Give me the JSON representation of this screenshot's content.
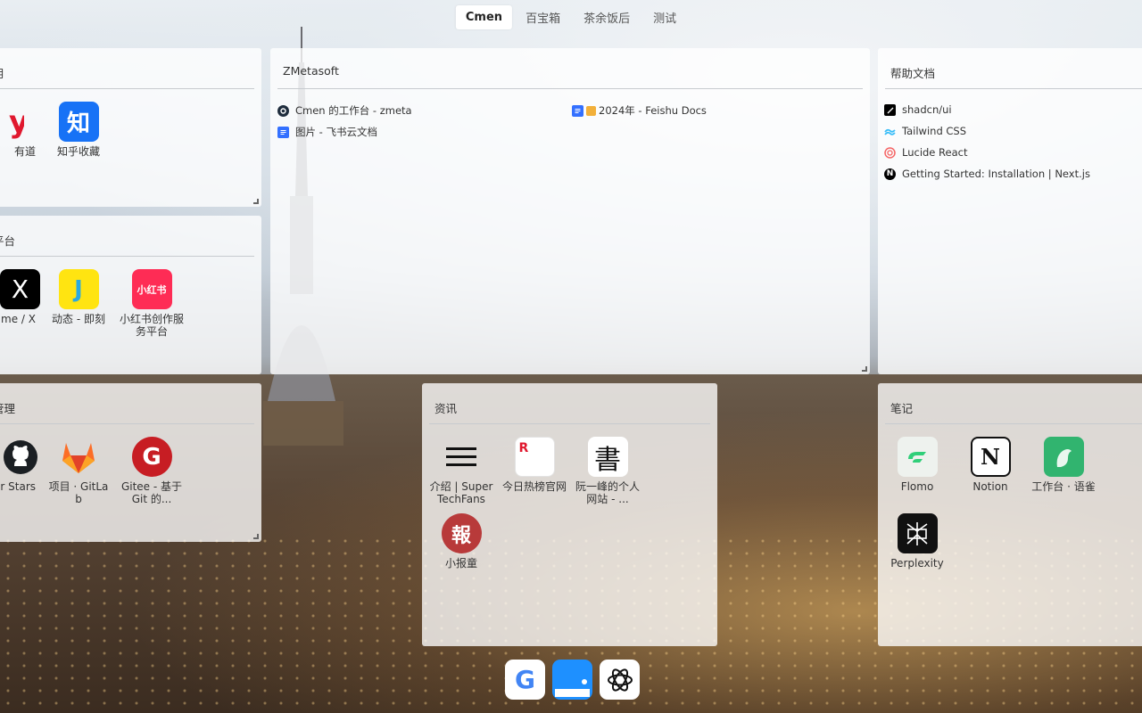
{
  "tabs": [
    "Cmen",
    "百宝箱",
    "茶余饭后",
    "测试"
  ],
  "cards": {
    "left_top": {
      "title": "用",
      "apps": [
        {
          "label": "有道",
          "icon": "youdao-icon"
        },
        {
          "label": "知乎收藏",
          "icon": "zhihu-icon",
          "glyph": "知"
        }
      ]
    },
    "left_mid": {
      "title": "平台",
      "apps": [
        {
          "label": "me / X",
          "icon": "x-icon",
          "glyph": "X"
        },
        {
          "label": "动态 - 即刻",
          "icon": "jike-icon",
          "glyph": "J"
        },
        {
          "label": "小红书创作服务平台",
          "icon": "xiaohongshu-icon",
          "glyph": "小红书"
        }
      ]
    },
    "left_bottom": {
      "title": "管理",
      "apps": [
        {
          "label": "r Stars",
          "icon": "github-icon"
        },
        {
          "label": "项目 · GitLab",
          "icon": "gitlab-icon"
        },
        {
          "label": "Gitee - 基于 Git 的...",
          "icon": "gitee-icon",
          "glyph": "G"
        }
      ]
    },
    "zmetasoft": {
      "title": "ZMetasoft",
      "links": [
        {
          "label": "Cmen 的工作台 - zmeta",
          "icon": "zmeta-icon"
        },
        {
          "label": "图片 - 飞书云文档",
          "icon": "feishu-doc-icon"
        },
        {
          "label": "2024年 - Feishu Docs",
          "icon": "feishu-doc-icon"
        }
      ]
    },
    "help": {
      "title": "帮助文档",
      "links": [
        {
          "label": "shadcn/ui",
          "icon": "shadcn-icon"
        },
        {
          "label": "Tailwind CSS",
          "icon": "tailwind-icon"
        },
        {
          "label": "Lucide React",
          "icon": "lucide-icon"
        },
        {
          "label": "Getting Started: Installation | Next.js",
          "icon": "nextjs-icon",
          "glyph": "N"
        }
      ]
    },
    "news": {
      "title": "资讯",
      "apps": [
        {
          "label": "介绍 | SuperTechFans",
          "icon": "menu-lines-icon"
        },
        {
          "label": "今日热榜官网",
          "icon": "tophub-icon",
          "glyph": "R"
        },
        {
          "label": "阮一峰的个人网站 - ...",
          "icon": "ruanyifeng-icon",
          "glyph": "書"
        },
        {
          "label": "小报童",
          "icon": "xiaobaotong-icon",
          "glyph": "報"
        }
      ]
    },
    "notes": {
      "title": "笔记",
      "apps": [
        {
          "label": "Flomo",
          "icon": "flomo-icon"
        },
        {
          "label": "Notion",
          "icon": "notion-icon",
          "glyph": "N"
        },
        {
          "label": "工作台 · 语雀",
          "icon": "yuque-icon"
        },
        {
          "label": "Perplexity",
          "icon": "perplexity-icon"
        }
      ]
    }
  },
  "dock": [
    {
      "icon": "google-icon",
      "glyph": "G"
    },
    {
      "icon": "chat-app-icon"
    },
    {
      "icon": "openai-icon"
    }
  ],
  "colors": {
    "zhihu": "#1772f6",
    "jike": "#ffe411",
    "xiaohongshu": "#fe2c55",
    "gitee": "#c71d23",
    "gitlab": "#e24329",
    "notion": "#000000",
    "yuque": "#31b46f",
    "flomo": "#30cf79"
  }
}
